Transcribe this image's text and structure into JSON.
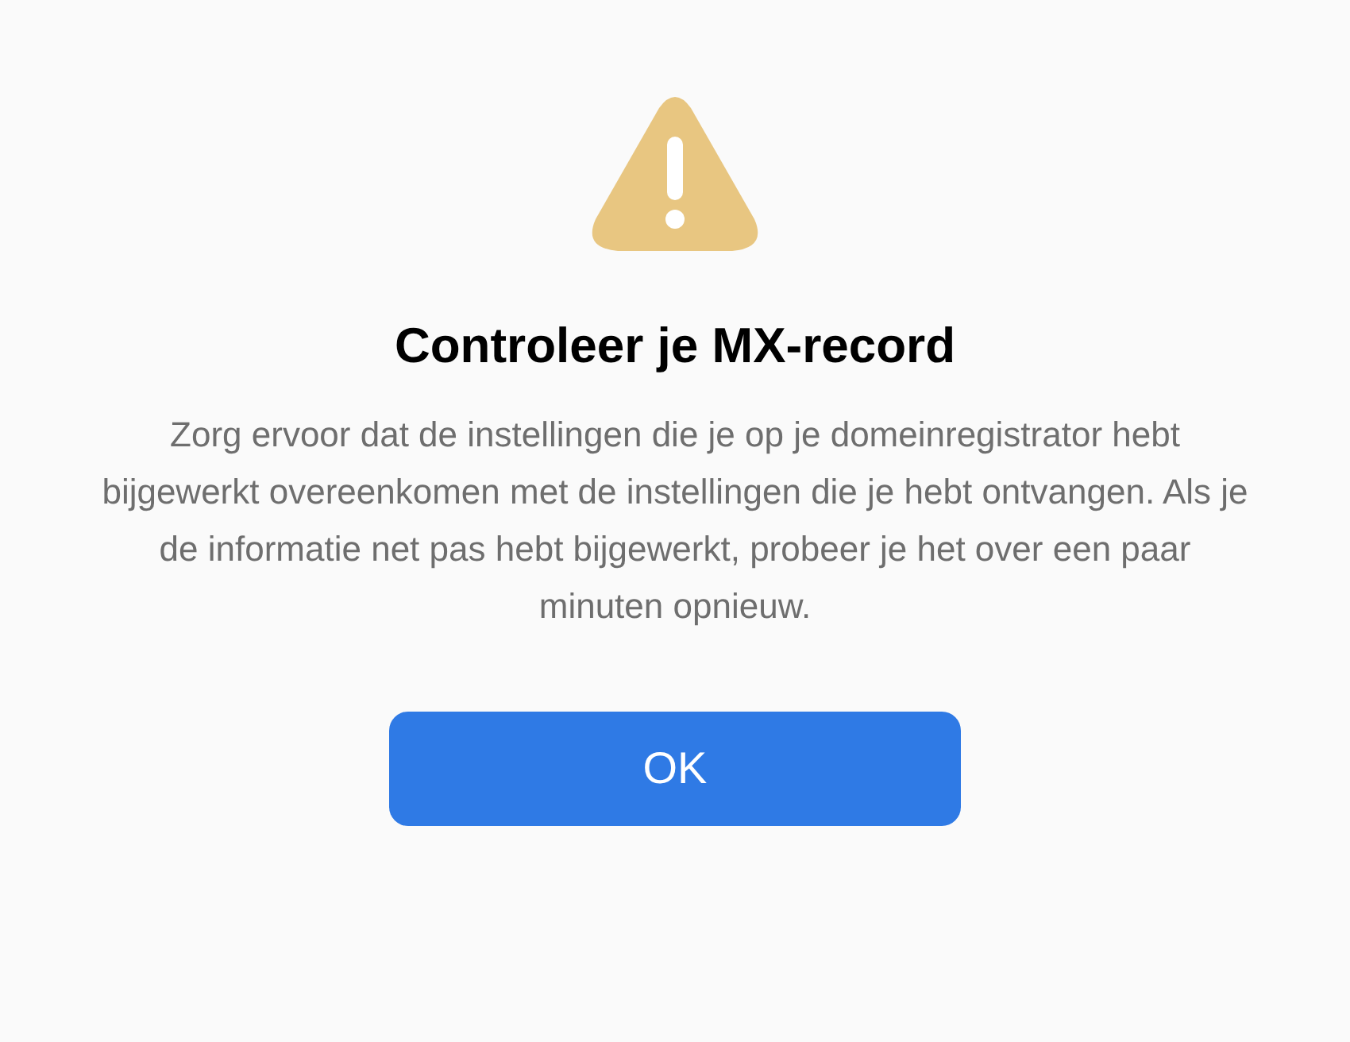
{
  "dialog": {
    "title": "Controleer je MX-record",
    "message": "Zorg ervoor dat de instellingen die je op je domeinregistrator hebt bijgewerkt overeenkomen met de instellingen die je hebt ontvangen. Als je de informatie net pas hebt bijgewerkt, probeer je het over een paar minuten opnieuw.",
    "buttons": [
      "OK"
    ]
  }
}
